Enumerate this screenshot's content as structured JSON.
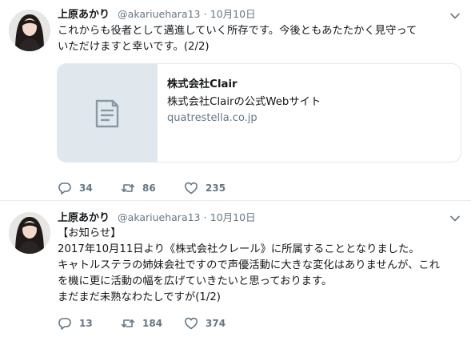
{
  "tweets": [
    {
      "author_name": "上原あかり",
      "handle": "@akariuehara13",
      "separator": "·",
      "date": "10月10日",
      "text_lines": [
        "これからも役者として邁進していく所存です。今後ともあたたかく見守って",
        "いただけますと幸いです。(2/2)"
      ],
      "card": {
        "icon": "document-icon",
        "title": "株式会社Clair",
        "description": "株式会社Clairの公式Webサイト",
        "url": "quatrestella.co.jp"
      },
      "actions": {
        "replies": "34",
        "retweets": "86",
        "likes": "235"
      }
    },
    {
      "author_name": "上原あかり",
      "handle": "@akariuehara13",
      "separator": "·",
      "date": "10月10日",
      "text_lines": [
        "【お知らせ】",
        "2017年10月11日より《株式会社クレール》に所属することとなりました。",
        "キャトルステラの姉妹会社ですので声優活動に大きな変化はありませんが、これ",
        "を機に更に活動の幅を広げていきたいと思っております。",
        "まだまだ未熟なわたしですが(1/2)"
      ],
      "actions": {
        "replies": "13",
        "retweets": "184",
        "likes": "374"
      }
    }
  ],
  "icons": [
    "chevron-down-icon",
    "reply-icon",
    "retweet-icon",
    "heart-icon",
    "document-icon"
  ],
  "colors": {
    "text": "#14171a",
    "secondary": "#657786",
    "border": "#e1e8ed",
    "thumb_bg": "#e1e8ed"
  }
}
